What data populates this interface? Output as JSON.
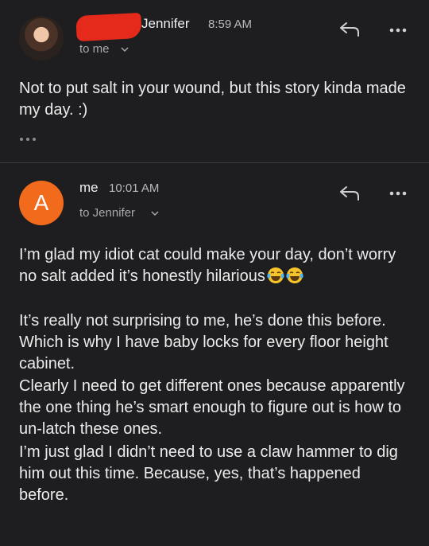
{
  "message1": {
    "sender": "Jennifer",
    "time": "8:59 AM",
    "to_label": "to me",
    "body": "Not to put salt in your wound, but this story kinda made my day.  :)",
    "avatar_icon": "profile-photo"
  },
  "message2": {
    "avatar_letter": "A",
    "sender": "me",
    "time": "10:01 AM",
    "to_label": "to Jennifer",
    "line1_text": "I’m glad my idiot cat could make your day, don’t worry no salt added it’s honestly hilarious",
    "paragraph2": "It’s really not surprising to me, he’s done this before. Which is why I have baby locks for every floor height cabinet.",
    "paragraph3": "Clearly I need to get different ones because apparently the one thing he’s smart enough to figure out is how to un-latch these ones.",
    "paragraph4": "I’m just glad I didn’t need to use a claw hammer to dig him out this time. Because, yes, that’s happened before.",
    "emoji_icon": "laughing-crying-emoji"
  },
  "colors": {
    "background": "#1e1e20",
    "avatar_accent": "#f26b1d",
    "redaction": "#e52a1c"
  }
}
